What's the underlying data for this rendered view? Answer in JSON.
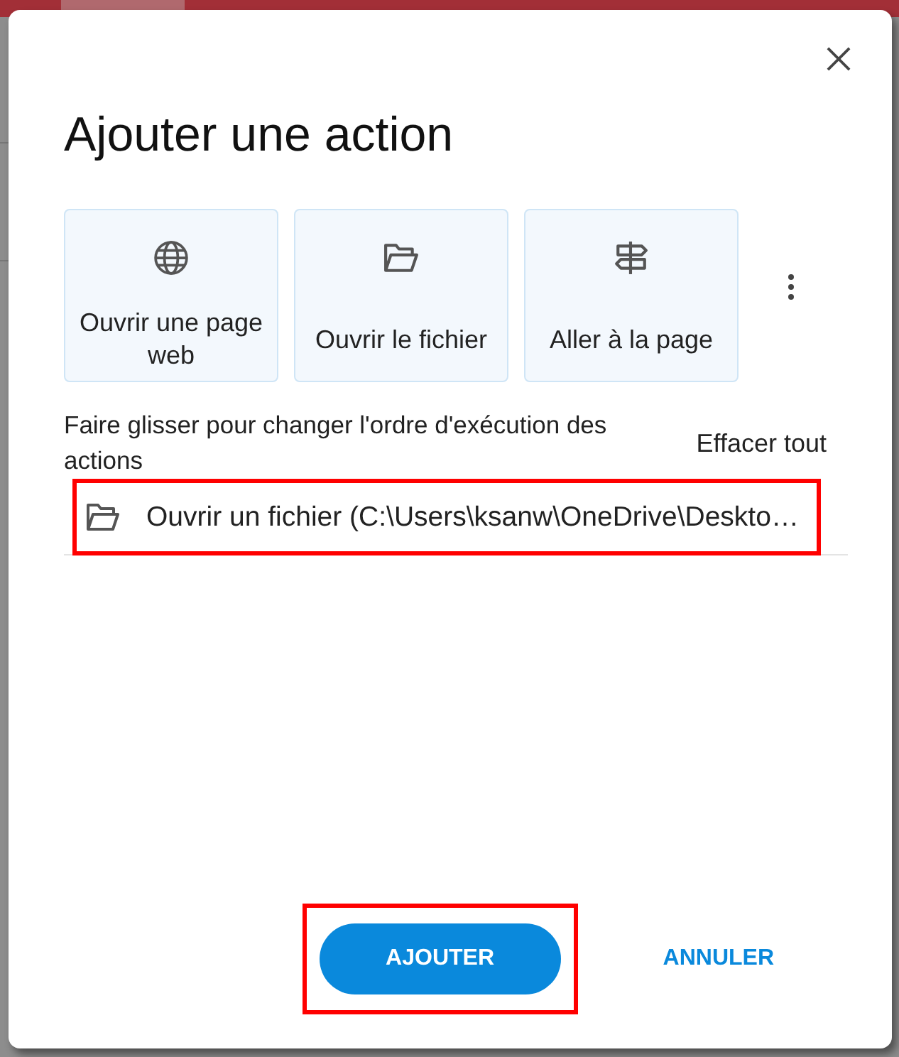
{
  "dialog": {
    "title": "Ajouter une action"
  },
  "action_types": [
    {
      "kind": "web",
      "label": "Ouvrir une page web"
    },
    {
      "kind": "file",
      "label": "Ouvrir le fichier"
    },
    {
      "kind": "page",
      "label": "Aller à la page"
    }
  ],
  "instructions": "Faire glisser pour changer l'ordre d'exécution des actions",
  "clear_all": "Effacer tout",
  "actions": [
    {
      "kind": "file",
      "label": "Ouvrir un fichier (C:\\Users\\ksanw\\OneDrive\\Deskto…",
      "highlighted": true
    }
  ],
  "buttons": [
    {
      "kind": "primary",
      "label": "AJOUTER",
      "highlighted": true
    },
    {
      "kind": "text",
      "label": "ANNULER",
      "highlighted": false
    }
  ]
}
